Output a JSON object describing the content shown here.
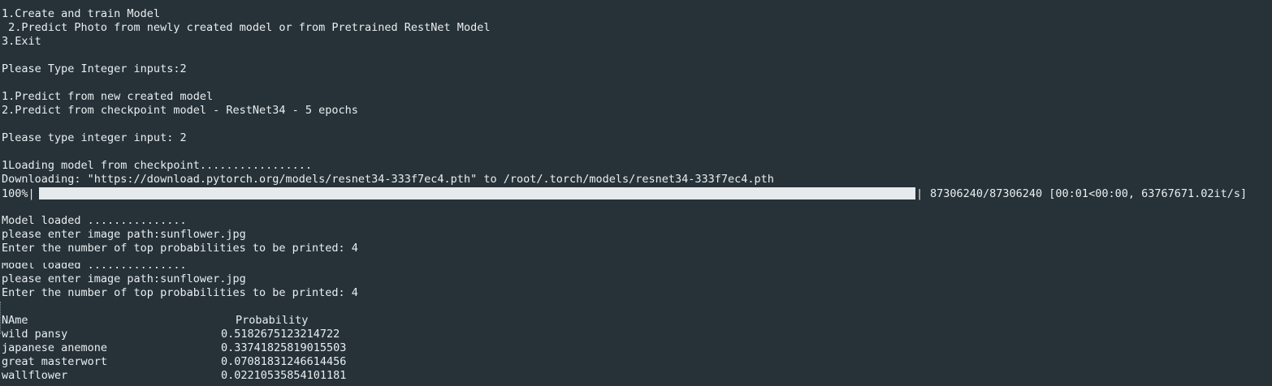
{
  "terminal": {
    "menu_line1": "1.Create and train Model",
    "menu_line2": " 2.Predict Photo from newly created model or from Pretrained RestNet Model",
    "menu_line3": "3.Exit",
    "prompt1": "Please Type Integer inputs:2",
    "sub_line1": "1.Predict from new created model",
    "sub_line2": "2.Predict from checkpoint model - RestNet34 - 5 epochs",
    "prompt2": "Please type integer input: 2",
    "loading": "1Loading model from checkpoint.................",
    "downloading": "Downloading: \"https://download.pytorch.org/models/resnet34-333f7ec4.pth\" to /root/.torch/models/resnet34-333f7ec4.pth",
    "progress_pct": "100%|",
    "progress_fraction": 1.0,
    "progress_pipe": "|",
    "progress_stats": "87306240/87306240 [00:01<00:00, 63767671.02it/s]",
    "model_loaded_1": "Model loaded ...............",
    "image_path_1": "please enter image path:sunflower.jpg",
    "topk_1": "Enter the number of top probabilities to be printed: 4",
    "model_loaded_2": "Model loaded ...............",
    "image_path_2": "please enter image path:sunflower.jpg",
    "topk_2": "Enter the number of top probabilities to be printed: 4"
  },
  "results": {
    "header_name": "NAme",
    "header_prob": "Probability",
    "rows": [
      {
        "name": "wild pansy",
        "prob": "0.5182675123214722"
      },
      {
        "name": "japanese anemone",
        "prob": "0.33741825819015503"
      },
      {
        "name": "great masterwort",
        "prob": "0.07081831246614456"
      },
      {
        "name": "wallflower",
        "prob": "0.02210535854101181"
      }
    ]
  }
}
